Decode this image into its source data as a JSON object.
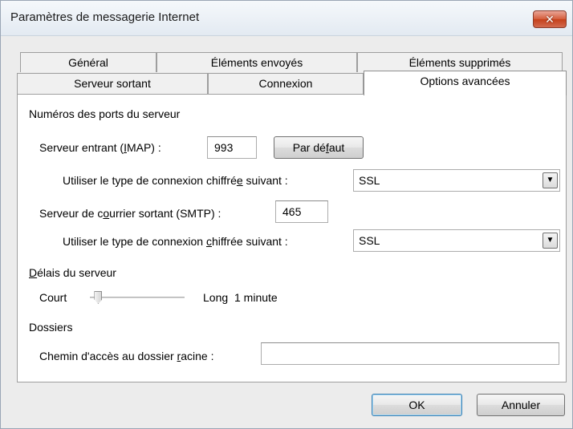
{
  "window": {
    "title": "Paramètres de messagerie Internet",
    "close_glyph": "✕"
  },
  "tabs": {
    "row_back": [
      "Général",
      "Éléments envoyés",
      "Éléments supprimés"
    ],
    "row_front": [
      "Serveur sortant",
      "Connexion",
      "Options avancées"
    ],
    "active": "Options avancées"
  },
  "ports": {
    "group_title": "Numéros des ports du serveur",
    "incoming_label_pre": "Serveur entrant (",
    "incoming_label_u": "I",
    "incoming_label_post": "MAP) :",
    "incoming_value": "993",
    "default_button_pre": "Par dé",
    "default_button_u": "f",
    "default_button_post": "aut",
    "incoming_encryption_label_pre": "Utiliser le type de connexion chiffré",
    "incoming_encryption_label_u": "e",
    "incoming_encryption_label_post": " suivant :",
    "incoming_encryption_value": "SSL",
    "outgoing_label_pre": "Serveur de c",
    "outgoing_label_u": "o",
    "outgoing_label_post": "urrier sortant (SMTP) :",
    "outgoing_value": "465",
    "outgoing_encryption_label_pre": "Utiliser le type de connexion ",
    "outgoing_encryption_label_u": "c",
    "outgoing_encryption_label_post": "hiffrée suivant :",
    "outgoing_encryption_value": "SSL",
    "dropdown_icon": "triangle-down-icon"
  },
  "timeouts": {
    "group_title_u": "D",
    "group_title_post": "élais du serveur",
    "short_label": "Court",
    "long_label": "Long",
    "value_text": "1 minute",
    "slider_level": 0.05
  },
  "folders": {
    "group_title": "Dossiers",
    "root_label_pre": "Chemin d'accès au dossier ",
    "root_label_u": "r",
    "root_label_post": "acine :",
    "root_value": ""
  },
  "footer": {
    "ok_label": "OK",
    "cancel_label": "Annuler"
  }
}
